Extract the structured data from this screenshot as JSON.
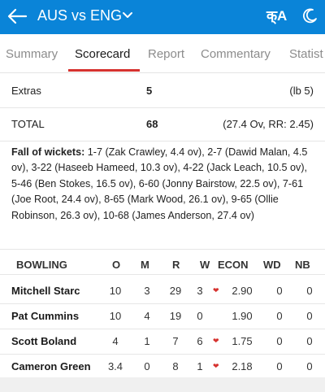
{
  "header": {
    "title": "AUS vs ENG",
    "brand": "क्A"
  },
  "tabs": [
    "Summary",
    "Scorecard",
    "Report",
    "Commentary",
    "Statist"
  ],
  "active_tab": "Scorecard",
  "extras": {
    "label": "Extras",
    "value": "5",
    "detail": "(lb 5)"
  },
  "total": {
    "label": "TOTAL",
    "value": "68",
    "detail": "(27.4 Ov, RR: 2.45)"
  },
  "fall_of_wickets": {
    "heading": "Fall of wickets:",
    "text": " 1-7 (Zak Crawley, 4.4 ov), 2-7 (Dawid Malan, 4.5 ov), 3-22 (Haseeb Hameed, 10.3 ov), 4-22 (Jack Leach, 10.5 ov), 5-46 (Ben Stokes, 16.5 ov), 6-60 (Jonny Bairstow, 22.5 ov), 7-61 (Joe Root, 24.4 ov), 8-65 (Mark Wood, 26.1 ov), 9-65 (Ollie Robinson, 26.3 ov), 10-68 (James Anderson, 27.4 ov)"
  },
  "bowling": {
    "headers": [
      "BOWLING",
      "O",
      "M",
      "R",
      "W",
      "ECON",
      "WD",
      "NB"
    ],
    "rows": [
      {
        "name": "Mitchell Starc",
        "o": "10",
        "m": "3",
        "r": "29",
        "w": "3",
        "econ": "2.90",
        "wd": "0",
        "nb": "0",
        "fav": true
      },
      {
        "name": "Pat Cummins",
        "o": "10",
        "m": "4",
        "r": "19",
        "w": "0",
        "econ": "1.90",
        "wd": "0",
        "nb": "0",
        "fav": false
      },
      {
        "name": "Scott Boland",
        "o": "4",
        "m": "1",
        "r": "7",
        "w": "6",
        "econ": "1.75",
        "wd": "0",
        "nb": "0",
        "fav": true
      },
      {
        "name": "Cameron Green",
        "o": "3.4",
        "m": "0",
        "r": "8",
        "w": "1",
        "econ": "2.18",
        "wd": "0",
        "nb": "0",
        "fav": true
      }
    ]
  },
  "colors": {
    "appbar": "#0a84d8",
    "accent": "#d6322f"
  },
  "icons": [
    "back-arrow-icon",
    "chevron-down-icon",
    "moon-icon",
    "heart-icon"
  ]
}
